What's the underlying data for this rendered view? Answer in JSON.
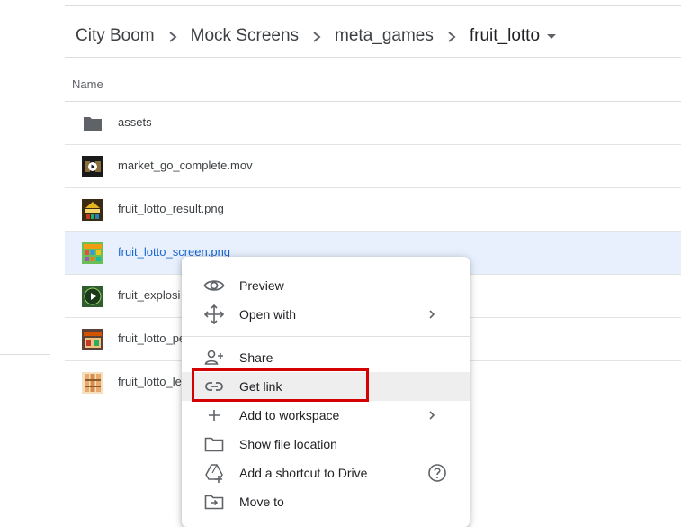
{
  "breadcrumb": {
    "items": [
      "City Boom",
      "Mock Screens",
      "meta_games",
      "fruit_lotto"
    ]
  },
  "list": {
    "column_name": "Name",
    "files": [
      {
        "name": "assets",
        "type": "folder"
      },
      {
        "name": "market_go_complete.mov",
        "type": "video"
      },
      {
        "name": "fruit_lotto_result.png",
        "type": "image"
      },
      {
        "name": "fruit_lotto_screen.png",
        "type": "image",
        "selected": true
      },
      {
        "name": "fruit_explosi",
        "type": "video"
      },
      {
        "name": "fruit_lotto_pe",
        "type": "image"
      },
      {
        "name": "fruit_lotto_le",
        "type": "image"
      }
    ]
  },
  "context_menu": {
    "items": [
      {
        "label": "Preview",
        "icon": "eye-icon"
      },
      {
        "label": "Open with",
        "icon": "move-arrows-icon",
        "submenu": true
      },
      {
        "label": "Share",
        "icon": "person-add-icon"
      },
      {
        "label": "Get link",
        "icon": "link-icon",
        "highlighted": true
      },
      {
        "label": "Add to workspace",
        "icon": "plus-icon",
        "submenu": true
      },
      {
        "label": "Show file location",
        "icon": "folder-outline-icon"
      },
      {
        "label": "Add a shortcut to Drive",
        "icon": "drive-shortcut-icon",
        "help": true
      },
      {
        "label": "Move to",
        "icon": "move-to-folder-icon"
      }
    ]
  },
  "colors": {
    "selected_row": "#e8f0fe",
    "selected_text": "#1967d2",
    "highlight_box": "#d50000"
  }
}
